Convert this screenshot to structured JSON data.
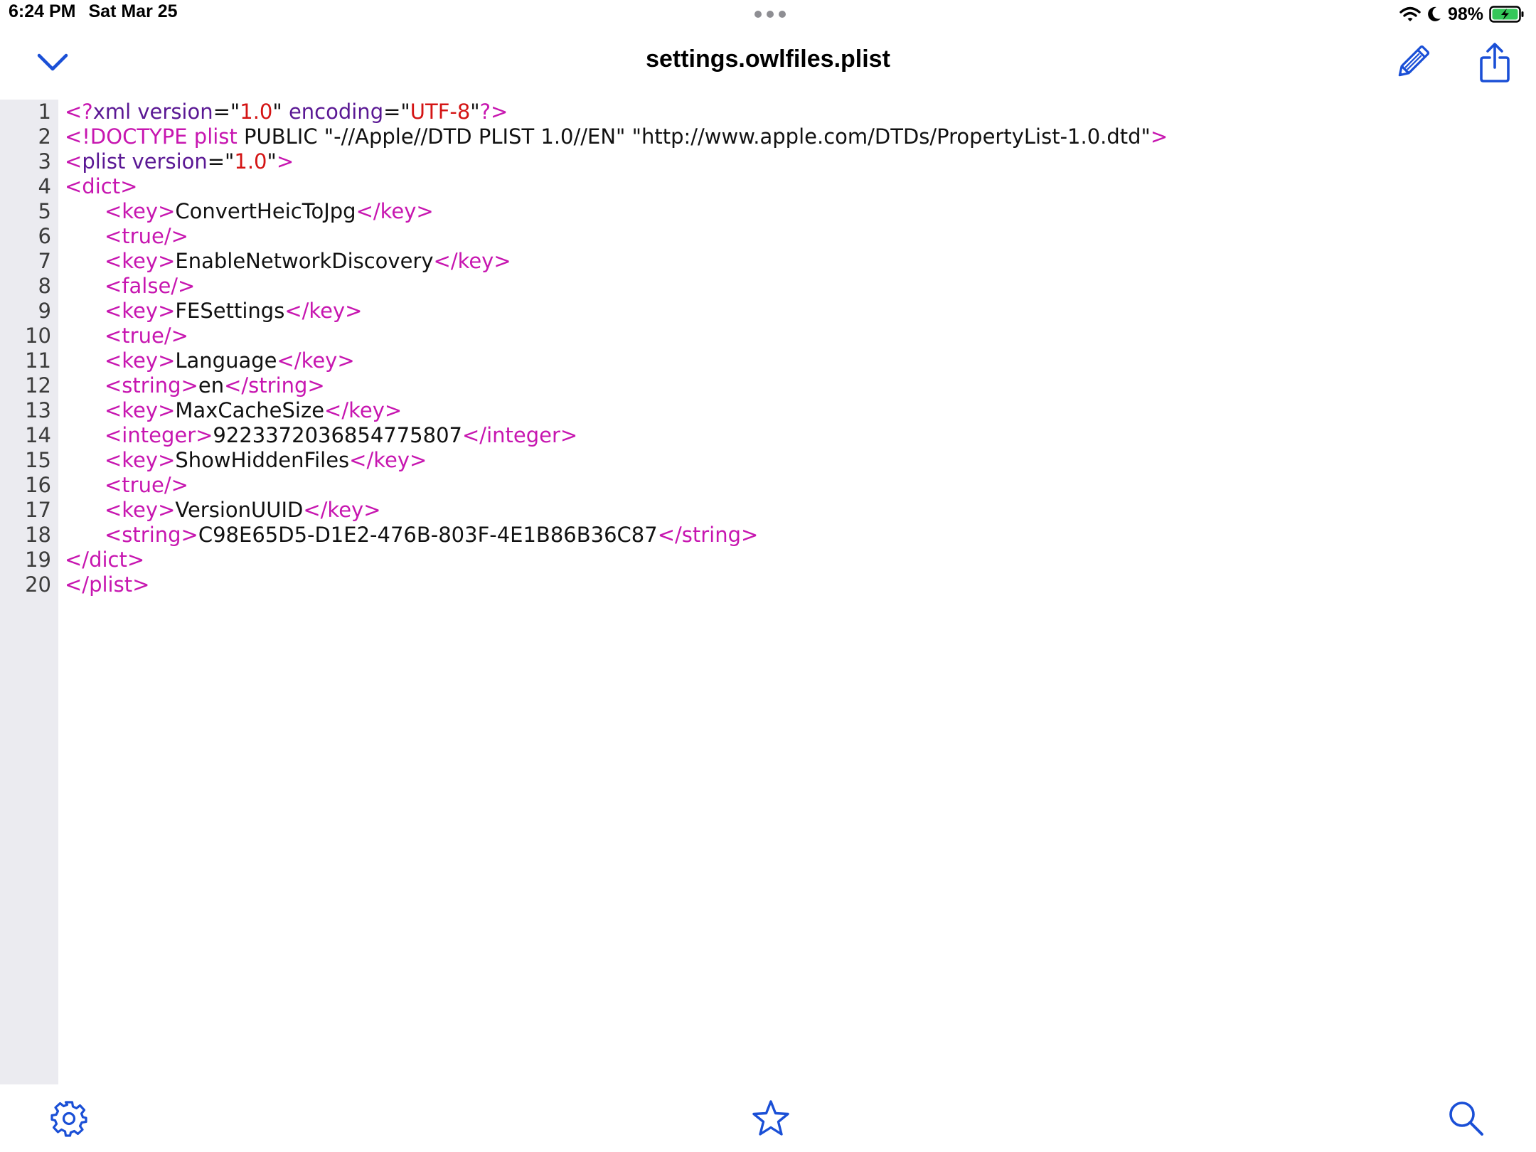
{
  "status_bar": {
    "time": "6:24 PM",
    "date": "Sat Mar 25",
    "battery": "98%"
  },
  "nav": {
    "title": "settings.owlfiles.plist"
  },
  "colors": {
    "accent": "#1a4fd6",
    "tag": "#c716b0",
    "attribute": "#5a1894",
    "value": "#d41414",
    "text": "#111111",
    "gutter": "#ebebf0",
    "battery_fill": "#34c759"
  },
  "icons": {
    "back": "chevron-down-icon",
    "edit": "pencil-icon",
    "share": "share-icon",
    "settings": "gear-icon",
    "favorite": "star-icon",
    "search": "magnifier-icon"
  },
  "lines": [
    {
      "n": "1",
      "indent": false,
      "segs": [
        [
          "tag",
          "<?"
        ],
        [
          "attr",
          "xml version"
        ],
        [
          "plain",
          "=\""
        ],
        [
          "val",
          "1.0"
        ],
        [
          "plain",
          "\" "
        ],
        [
          "attr",
          "encoding"
        ],
        [
          "plain",
          "=\""
        ],
        [
          "val",
          "UTF-8"
        ],
        [
          "plain",
          "\""
        ],
        [
          "tag",
          "?>"
        ]
      ]
    },
    {
      "n": "2",
      "indent": false,
      "segs": [
        [
          "tag",
          "<!DOCTYPE plist"
        ],
        [
          "plain",
          " PUBLIC \"-//Apple//DTD PLIST 1.0//EN\" \"http://www.apple.com/DTDs/PropertyList-1.0.dtd\""
        ],
        [
          "tag",
          ">"
        ]
      ]
    },
    {
      "n": "3",
      "indent": false,
      "segs": [
        [
          "tag",
          "<"
        ],
        [
          "attr",
          "plist version"
        ],
        [
          "plain",
          "=\""
        ],
        [
          "val",
          "1.0"
        ],
        [
          "plain",
          "\""
        ],
        [
          "tag",
          ">"
        ]
      ]
    },
    {
      "n": "4",
      "indent": false,
      "segs": [
        [
          "tag",
          "<dict>"
        ]
      ]
    },
    {
      "n": "5",
      "indent": true,
      "segs": [
        [
          "tag",
          "<key>"
        ],
        [
          "plain",
          "ConvertHeicToJpg"
        ],
        [
          "tag",
          "</key>"
        ]
      ]
    },
    {
      "n": "6",
      "indent": true,
      "segs": [
        [
          "tag",
          "<true/>"
        ]
      ]
    },
    {
      "n": "7",
      "indent": true,
      "segs": [
        [
          "tag",
          "<key>"
        ],
        [
          "plain",
          "EnableNetworkDiscovery"
        ],
        [
          "tag",
          "</key>"
        ]
      ]
    },
    {
      "n": "8",
      "indent": true,
      "segs": [
        [
          "tag",
          "<false/>"
        ]
      ]
    },
    {
      "n": "9",
      "indent": true,
      "segs": [
        [
          "tag",
          "<key>"
        ],
        [
          "plain",
          "FESettings"
        ],
        [
          "tag",
          "</key>"
        ]
      ]
    },
    {
      "n": "10",
      "indent": true,
      "segs": [
        [
          "tag",
          "<true/>"
        ]
      ]
    },
    {
      "n": "11",
      "indent": true,
      "segs": [
        [
          "tag",
          "<key>"
        ],
        [
          "plain",
          "Language"
        ],
        [
          "tag",
          "</key>"
        ]
      ]
    },
    {
      "n": "12",
      "indent": true,
      "segs": [
        [
          "tag",
          "<string>"
        ],
        [
          "plain",
          "en"
        ],
        [
          "tag",
          "</string>"
        ]
      ]
    },
    {
      "n": "13",
      "indent": true,
      "segs": [
        [
          "tag",
          "<key>"
        ],
        [
          "plain",
          "MaxCacheSize"
        ],
        [
          "tag",
          "</key>"
        ]
      ]
    },
    {
      "n": "14",
      "indent": true,
      "segs": [
        [
          "tag",
          "<integer>"
        ],
        [
          "plain",
          "9223372036854775807"
        ],
        [
          "tag",
          "</integer>"
        ]
      ]
    },
    {
      "n": "15",
      "indent": true,
      "segs": [
        [
          "tag",
          "<key>"
        ],
        [
          "plain",
          "ShowHiddenFiles"
        ],
        [
          "tag",
          "</key>"
        ]
      ]
    },
    {
      "n": "16",
      "indent": true,
      "segs": [
        [
          "tag",
          "<true/>"
        ]
      ]
    },
    {
      "n": "17",
      "indent": true,
      "segs": [
        [
          "tag",
          "<key>"
        ],
        [
          "plain",
          "VersionUUID"
        ],
        [
          "tag",
          "</key>"
        ]
      ]
    },
    {
      "n": "18",
      "indent": true,
      "segs": [
        [
          "tag",
          "<string>"
        ],
        [
          "plain",
          "C98E65D5-D1E2-476B-803F-4E1B86B36C87"
        ],
        [
          "tag",
          "</string>"
        ]
      ]
    },
    {
      "n": "19",
      "indent": false,
      "segs": [
        [
          "tag",
          "</dict>"
        ]
      ]
    },
    {
      "n": "20",
      "indent": false,
      "segs": [
        [
          "tag",
          "</plist>"
        ]
      ]
    }
  ]
}
